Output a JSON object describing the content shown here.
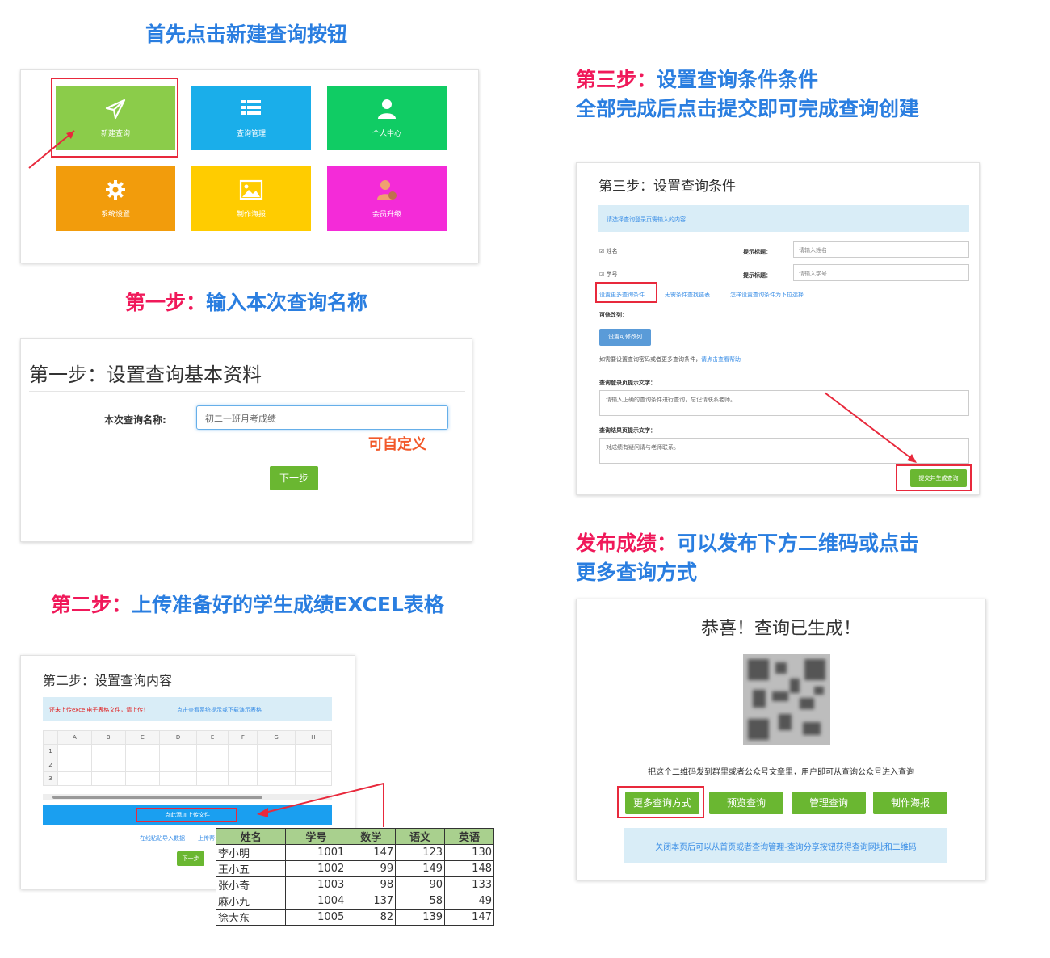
{
  "headings": {
    "intro": "首先点击新建查询按钮",
    "step1_prefix": "第一步：",
    "step1_text": "输入本次查询名称",
    "step2_prefix": "第二步：",
    "step2_text": "上传准备好的学生成绩EXCEL表格",
    "step3_prefix": "第三步：",
    "step3_text": "设置查询条件条件",
    "step3_line2": "全部完成后点击提交即可完成查询创建",
    "publish_prefix": "发布成绩：",
    "publish_text": "可以发布下方二维码或点击",
    "publish_line2": "更多查询方式"
  },
  "menu": {
    "tiles": [
      {
        "label": "新建查询",
        "icon": "paper-plane-icon",
        "color": "#8bcc4a"
      },
      {
        "label": "查询管理",
        "icon": "list-icon",
        "color": "#1aaeea"
      },
      {
        "label": "个人中心",
        "icon": "user-icon",
        "color": "#10cc64"
      },
      {
        "label": "系统设置",
        "icon": "gear-icon",
        "color": "#f29c0c"
      },
      {
        "label": "制作海报",
        "icon": "image-icon",
        "color": "#ffcc00"
      },
      {
        "label": "会员升级",
        "icon": "vip-user-icon",
        "color": "#f42bd8"
      }
    ]
  },
  "step1": {
    "title": "第一步：设置查询基本资料",
    "field_label": "本次查询名称:",
    "field_value": "初二一班月考成绩",
    "hint": "可自定义",
    "next_button": "下一步"
  },
  "step2": {
    "title": "第二步：设置查询内容",
    "alert_red": "还未上传excel电子表格文件，请上传！",
    "alert_link": "点击查看系统提示或下载演示表格",
    "columns": [
      "A",
      "B",
      "C",
      "D",
      "E",
      "F",
      "G",
      "H"
    ],
    "rows": [
      "1",
      "2",
      "3"
    ],
    "upload_button": "点此添加上传文件",
    "link_online": "在线粘贴导入数据",
    "link_other": "上传帮",
    "next_button": "下一步"
  },
  "scores": {
    "headers": [
      "姓名",
      "学号",
      "数学",
      "语文",
      "英语"
    ],
    "rows": [
      [
        "李小明",
        "1001",
        "147",
        "123",
        "130"
      ],
      [
        "王小五",
        "1002",
        "99",
        "149",
        "148"
      ],
      [
        "张小奇",
        "1003",
        "98",
        "90",
        "133"
      ],
      [
        "麻小九",
        "1004",
        "137",
        "58",
        "49"
      ],
      [
        "徐大东",
        "1005",
        "82",
        "139",
        "147"
      ]
    ]
  },
  "step3": {
    "title": "第三步：设置查询条件",
    "info": "请选择查询登录页需输入的内容",
    "cond1_label": "姓名",
    "cond1_hint_label": "提示标题：",
    "cond1_placeholder": "请输入姓名",
    "cond2_label": "学号",
    "cond2_hint_label": "提示标题：",
    "cond2_placeholder": "请输入学号",
    "link_more": "设置更多查询条件",
    "link_none": "无需条件查找链表",
    "link_dropdown": "怎样设置查询条件为下拉选择",
    "editable_label": "可修改列：",
    "editable_button": "设置可修改列",
    "help_text": "如需要设置查询密码或者更多查询条件，",
    "help_link": "请点击查看帮助",
    "login_text_label": "查询登录页提示文字：",
    "login_text_value": "请输入正确的查询条件进行查询，忘记请联系老师。",
    "result_text_label": "查询结果页提示文字：",
    "result_text_value": "对成绩有疑问请与老师联系。",
    "submit_button": "提交并生成查询"
  },
  "publish": {
    "title": "恭喜！查询已生成！",
    "description": "把这个二维码发到群里或者公众号文章里，用户即可从查询公众号进入查询",
    "buttons": [
      "更多查询方式",
      "预览查询",
      "管理查询",
      "制作海报"
    ],
    "note": "关闭本页后可以从首页或者查询管理-查询分享按钮获得查询网址和二维码"
  },
  "colors": {
    "accent_red": "#f0195a",
    "accent_blue": "#2a7ee0",
    "button_green": "#6ab731",
    "highlight_red": "#e8293c"
  }
}
